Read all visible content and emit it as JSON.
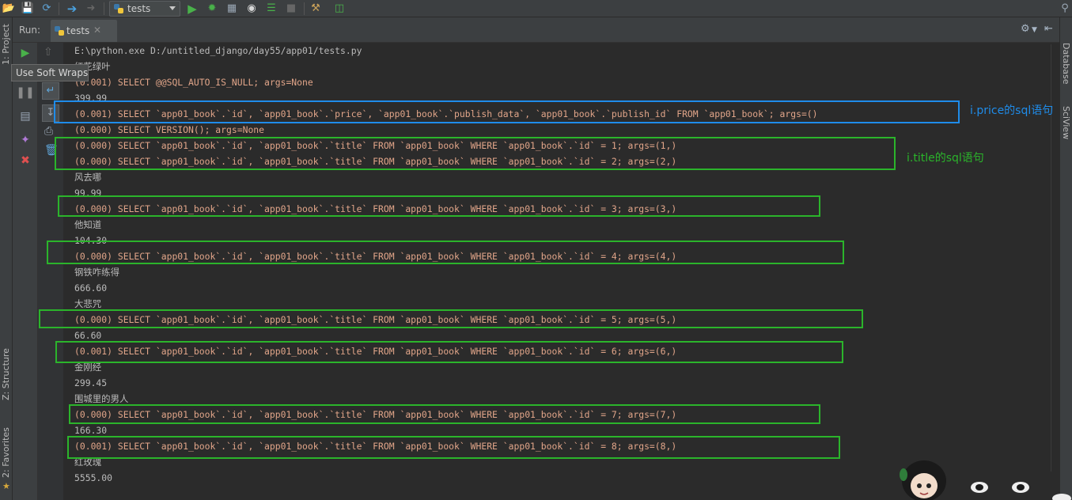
{
  "toolbar": {
    "run_config": "tests"
  },
  "left_strip": {
    "project_label": "1: Project",
    "structure_label": "Z: Structure",
    "favorites_label": "2: Favorites"
  },
  "run_panel": {
    "title": "Run:",
    "tab_label": "tests",
    "tooltip": "Use Soft Wraps"
  },
  "right_strip": {
    "database_label": "Database",
    "sciview_label": "SciView"
  },
  "console": {
    "lines": [
      {
        "text": "E:\\python.exe D:/untitled_django/day55/app01/tests.py",
        "kind": "cmd"
      },
      {
        "text": "红花绿叶",
        "kind": "out"
      },
      {
        "text": "(0.001) SELECT @@SQL_AUTO_IS_NULL; args=None",
        "kind": "sql"
      },
      {
        "text": "399.99",
        "kind": "out"
      },
      {
        "text": "(0.001) SELECT `app01_book`.`id`, `app01_book`.`price`, `app01_book`.`publish_data`, `app01_book`.`publish_id` FROM `app01_book`; args=()",
        "kind": "sql"
      },
      {
        "text": "(0.000) SELECT VERSION(); args=None",
        "kind": "sql"
      },
      {
        "text": "(0.000) SELECT `app01_book`.`id`, `app01_book`.`title` FROM `app01_book` WHERE `app01_book`.`id` = 1; args=(1,)",
        "kind": "sql"
      },
      {
        "text": "(0.000) SELECT `app01_book`.`id`, `app01_book`.`title` FROM `app01_book` WHERE `app01_book`.`id` = 2; args=(2,)",
        "kind": "sql"
      },
      {
        "text": "风去哪",
        "kind": "out"
      },
      {
        "text": "99.99",
        "kind": "out"
      },
      {
        "text": "(0.000) SELECT `app01_book`.`id`, `app01_book`.`title` FROM `app01_book` WHERE `app01_book`.`id` = 3; args=(3,)",
        "kind": "sql"
      },
      {
        "text": "他知道",
        "kind": "out"
      },
      {
        "text": "104.30",
        "kind": "out"
      },
      {
        "text": "(0.000) SELECT `app01_book`.`id`, `app01_book`.`title` FROM `app01_book` WHERE `app01_book`.`id` = 4; args=(4,)",
        "kind": "sql"
      },
      {
        "text": "钢铁咋练得",
        "kind": "out"
      },
      {
        "text": "666.60",
        "kind": "out"
      },
      {
        "text": "大悲咒",
        "kind": "out"
      },
      {
        "text": "(0.000) SELECT `app01_book`.`id`, `app01_book`.`title` FROM `app01_book` WHERE `app01_book`.`id` = 5; args=(5,)",
        "kind": "sql"
      },
      {
        "text": "66.60",
        "kind": "out"
      },
      {
        "text": "(0.001) SELECT `app01_book`.`id`, `app01_book`.`title` FROM `app01_book` WHERE `app01_book`.`id` = 6; args=(6,)",
        "kind": "sql"
      },
      {
        "text": "金刚经",
        "kind": "out"
      },
      {
        "text": "299.45",
        "kind": "out"
      },
      {
        "text": "围城里的男人",
        "kind": "out"
      },
      {
        "text": "(0.000) SELECT `app01_book`.`id`, `app01_book`.`title` FROM `app01_book` WHERE `app01_book`.`id` = 7; args=(7,)",
        "kind": "sql"
      },
      {
        "text": "166.30",
        "kind": "out"
      },
      {
        "text": "(0.001) SELECT `app01_book`.`id`, `app01_book`.`title` FROM `app01_book` WHERE `app01_book`.`id` = 8; args=(8,)",
        "kind": "sql"
      },
      {
        "text": "红玫瑰",
        "kind": "out"
      },
      {
        "text": "5555.00",
        "kind": "out"
      }
    ]
  },
  "annotations": {
    "price_label": "i.price的sql语句",
    "title_label": "i.title的sql语句",
    "price_color": "#1f8cea",
    "title_color": "#2bb42b"
  }
}
